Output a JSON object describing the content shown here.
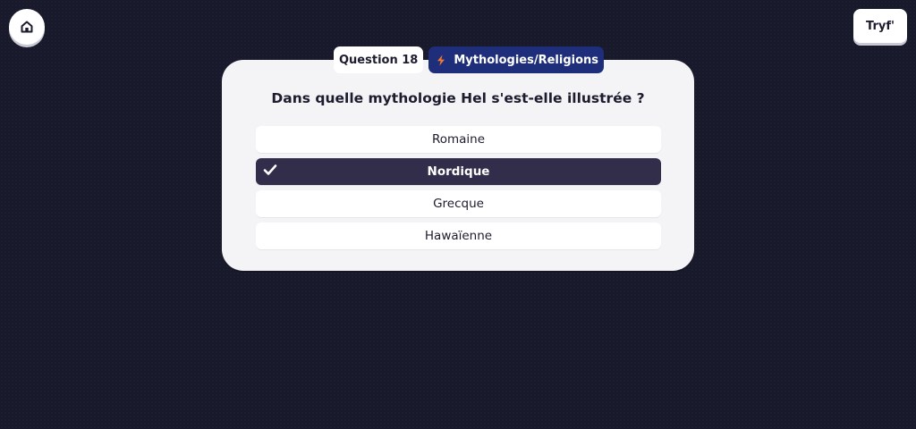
{
  "header": {
    "home_icon": "home-icon",
    "brand_label": "Tryf'"
  },
  "quiz": {
    "question_label": "Question 18",
    "category": {
      "icon": "lightning-icon",
      "label": "Mythologies/Religions"
    },
    "question_text": "Dans quelle mythologie Hel s'est-elle illustrée ?",
    "options": [
      {
        "label": "Romaine",
        "selected": false
      },
      {
        "label": "Nordique",
        "selected": true
      },
      {
        "label": "Grecque",
        "selected": false
      },
      {
        "label": "Hawaïenne",
        "selected": false
      }
    ]
  },
  "colors": {
    "background": "#181a2b",
    "card": "#f4f3f6",
    "category_badge": "#1f2e7a",
    "selected_option": "#322d4b",
    "bolt": "#f07a30"
  }
}
